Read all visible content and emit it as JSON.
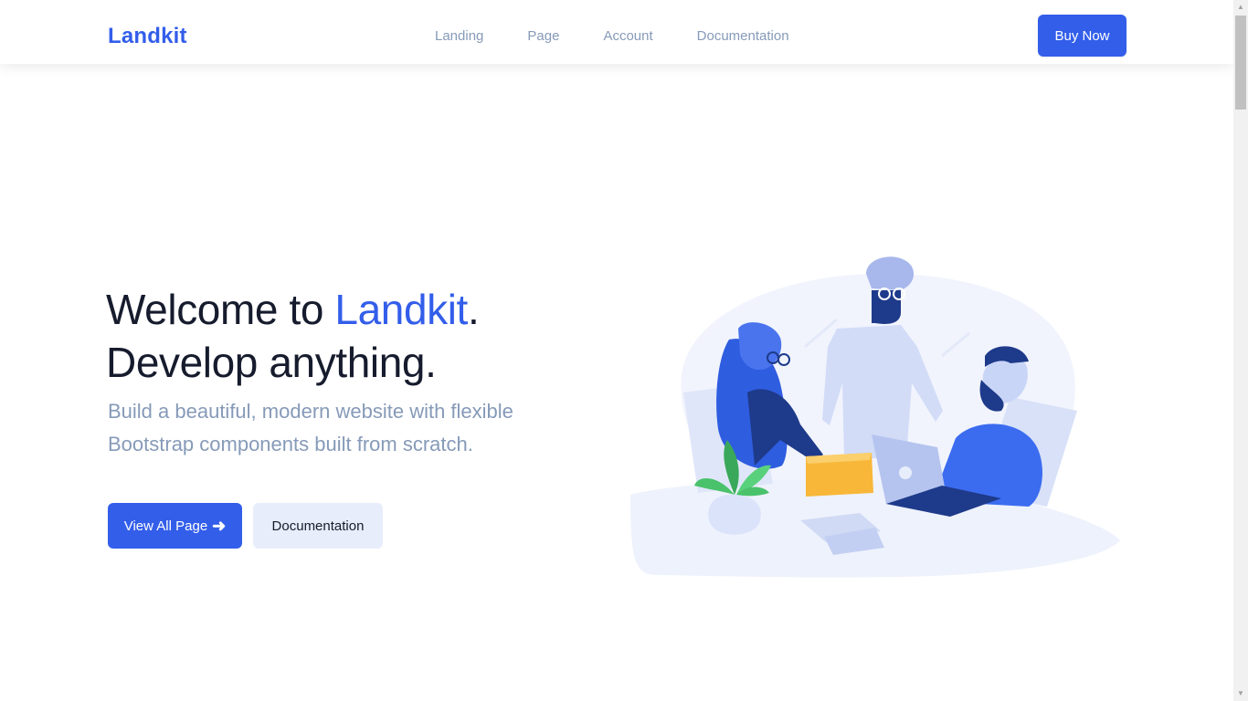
{
  "navbar": {
    "brand": "Landkit",
    "links": [
      "Landing",
      "Page",
      "Account",
      "Documentation"
    ],
    "cta": "Buy Now"
  },
  "hero": {
    "title_prefix": "Welcome to ",
    "title_accent": "Landkit",
    "title_suffix": ".",
    "title_line2": "Develop anything.",
    "subtitle": "Build a beautiful, modern website with flexible Bootstrap components built from scratch.",
    "primary_button": "View All Page",
    "primary_button_icon": "arrow-right-icon",
    "secondary_button": "Documentation"
  },
  "illustration": {
    "icon": "team-collaboration-illustration"
  },
  "colors": {
    "primary": "#335eea",
    "text_dark": "#161c2d",
    "text_muted": "#869ab8",
    "soft_button_bg": "#e8edfb",
    "illustration_orange": "#f8b739",
    "illustration_green": "#4ac26b"
  },
  "scrollbar": {
    "position_fraction": 0.0
  }
}
